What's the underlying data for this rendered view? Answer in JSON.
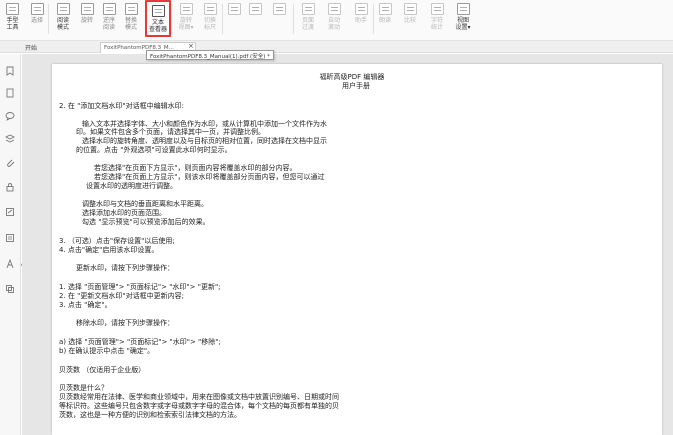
{
  "ribbon": {
    "buttons": [
      {
        "name": "hand-tool",
        "label": "手型\n工具",
        "style": "dark"
      },
      {
        "name": "select-tool",
        "label": "选择",
        "style": "normal"
      },
      {
        "name": "reading-mode",
        "label": "阅读\n模式",
        "style": "dark"
      },
      {
        "name": "rotate-view",
        "label": "旋转",
        "style": "normal"
      },
      {
        "name": "reverse-reading",
        "label": "逆序\n阅读",
        "style": "normal"
      },
      {
        "name": "replace-mode",
        "label": "替换\n模式",
        "style": "normal"
      },
      {
        "name": "text-viewer",
        "label": "文本\n查看器",
        "style": "dark"
      },
      {
        "name": "rotate-view-menu",
        "label": "旋转\n视图▾",
        "style": "dim"
      },
      {
        "name": "switch-ruler",
        "label": "切换\n标尺",
        "style": "dim"
      },
      {
        "name": "page-view-1",
        "label": "",
        "style": "dim"
      },
      {
        "name": "page-view-2",
        "label": "",
        "style": "dim"
      },
      {
        "name": "page-view-3",
        "label": "",
        "style": "dim"
      },
      {
        "name": "page-transition",
        "label": "页面\n过渡",
        "style": "dim"
      },
      {
        "name": "auto-scroll",
        "label": "自动\n滚动",
        "style": "dim"
      },
      {
        "name": "assistant",
        "label": "助手",
        "style": "dim"
      },
      {
        "name": "read-aloud",
        "label": "朗读",
        "style": "dim"
      },
      {
        "name": "compare",
        "label": "比较",
        "style": "dim"
      },
      {
        "name": "word-count",
        "label": "字符\n统计",
        "style": "dim"
      },
      {
        "name": "view-settings",
        "label": "视图\n设置▾",
        "style": "dark"
      }
    ]
  },
  "tabs": {
    "start_label": "开始",
    "doc_label": "FoxitPhantomPDF8.3_M...",
    "close_label": "×",
    "tooltip": "FoxitPhantomPDF8.3_Manual(1).pdf (安全) *"
  },
  "rail_icons": [
    "bookmark-icon",
    "pages-icon",
    "comments-icon",
    "layers-icon",
    "attachment-icon",
    "security-icon",
    "signature-icon",
    "form-icon",
    "destination-icon",
    "content-icon"
  ],
  "document": {
    "header": [
      "福昕高级PDF 编辑器",
      "用户手册"
    ],
    "lines": [
      "2. 在 \"添加文档水印\"对话框中编辑水印:",
      "输入文本并选择字体、大小和颜色作为水印，或从计算机中添加一个文件作为水",
      "印。如果文件包含多个页面，请选择其中一页，并调整比例。",
      "选择水印的旋转角度、透明度以及与目标页的相对位置，同时选择在文档中显示",
      "的位置。点击 \"外观选项\"可设置此水印何时显示。",
      "若您选择\"在页面下方显示\"，则页面内容将覆盖水印的部分内容。",
      "若您选择\"在页面上方显示\"，则该水印将覆盖部分页面内容，但您可以通过",
      "设置水印的透明度进行调整。",
      "调整水印与文档的垂直距离和水平距离。",
      "选择添加水印的页面范围。",
      "勾选 \"显示预览\"可以预览添加后的效果。",
      "3. （可选）点击\"保存设置\"以后使用;",
      "4. 点击\"确定\"启用该水印设置。",
      "更新水印，请按下列步骤操作：",
      "1. 选择 \"页面管理\"> \"页面标记\"> \"水印\"> \"更新\";",
      "2. 在 \"更新文档水印\"对话框中更新内容;",
      "3. 点击 \"确定\"。",
      "移除水印，请按下列步骤操作：",
      "a) 选择 \"页面管理\"> \"页面标记\"> \"水印\"> \"移除\";",
      "b) 在确认提示中点击 \"确定\"。",
      "贝茨数 （仅适用于企业版）",
      "贝茨数是什么？",
      "贝茨数经常用在法律、医学和商业领域中，用来在图像或文档中放置识别编号、日期或时间",
      "等标识符。这些编号只包含数字或字母或数字字母的混合体，每个文档的每页都有单独的贝",
      "茨数，这也是一种方便的识别和检索索引法律文档的方法。"
    ]
  }
}
